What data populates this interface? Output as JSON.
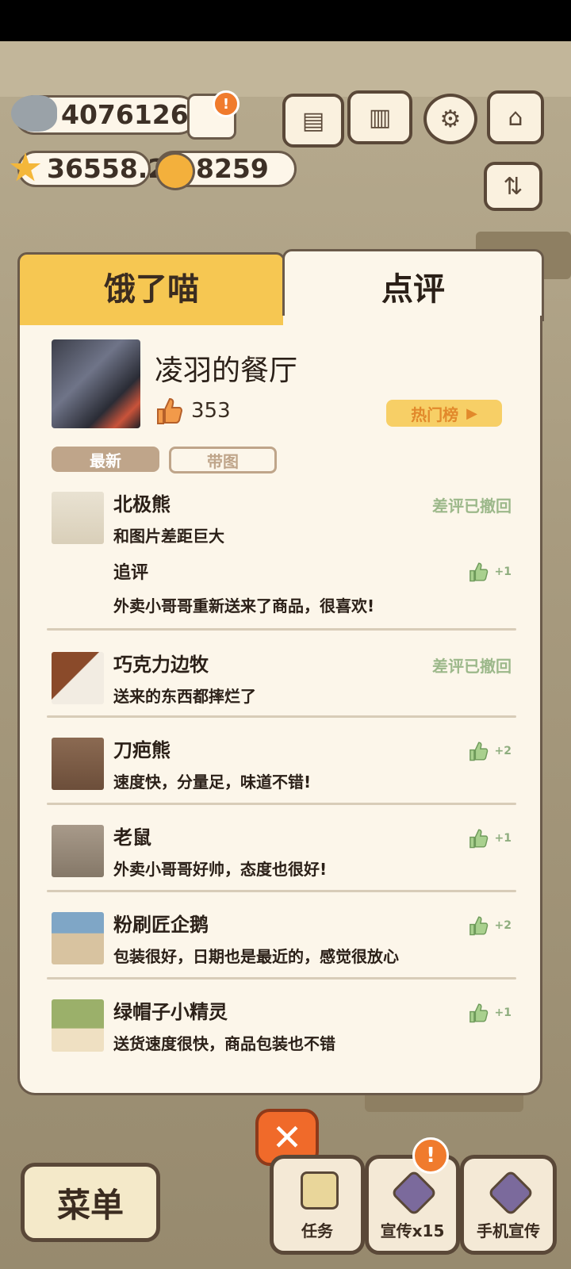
{
  "currency": {
    "fish": "4076126",
    "stars": "36558.2",
    "bells": "8259"
  },
  "tabs": {
    "left": "饿了喵",
    "right": "点评"
  },
  "restaurant": {
    "name": "凌羽的餐厅",
    "likes": "353",
    "hot_button": "热门榜"
  },
  "filters": {
    "newest": "最新",
    "with_image": "带图"
  },
  "reviews": [
    {
      "name": "北极熊",
      "text": "和图片差距巨大",
      "status": "差评已撤回",
      "followup_label": "追评",
      "followup_text": "外卖小哥哥重新送来了商品，很喜欢!",
      "followup_likes": "+1"
    },
    {
      "name": "巧克力边牧",
      "text": "送来的东西都摔烂了",
      "status": "差评已撤回"
    },
    {
      "name": "刀疤熊",
      "text": "速度快，分量足，味道不错!",
      "likes": "+2"
    },
    {
      "name": "老鼠",
      "text": "外卖小哥哥好帅，态度也很好!",
      "likes": "+1"
    },
    {
      "name": "粉刷匠企鹅",
      "text": "包装很好，日期也是最近的，感觉很放心",
      "likes": "+2"
    },
    {
      "name": "绿帽子小精灵",
      "text": "送货速度很快，商品包装也不错",
      "likes": "+1"
    }
  ],
  "bottom": {
    "menu": "菜单",
    "tasks": "任务",
    "promote": "宣传x15",
    "phone_promote": "手机宣传"
  },
  "colors": {
    "tab_yellow": "#f6c752",
    "panel_bg": "#fcf6ea",
    "border": "#6a5a4a",
    "accent_orange": "#f06a2a",
    "green_like": "#8fae7f"
  }
}
